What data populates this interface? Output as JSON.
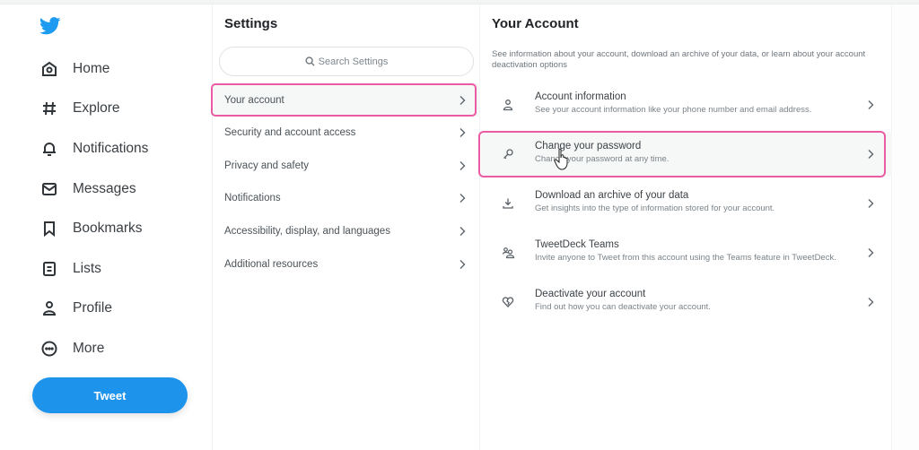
{
  "nav": {
    "logo": "twitter-bird-icon",
    "items": [
      {
        "label": "Home",
        "icon": "home-icon"
      },
      {
        "label": "Explore",
        "icon": "hashtag-icon"
      },
      {
        "label": "Notifications",
        "icon": "bell-icon"
      },
      {
        "label": "Messages",
        "icon": "envelope-icon"
      },
      {
        "label": "Bookmarks",
        "icon": "bookmark-icon"
      },
      {
        "label": "Lists",
        "icon": "list-icon"
      },
      {
        "label": "Profile",
        "icon": "person-icon"
      },
      {
        "label": "More",
        "icon": "more-circle-icon"
      }
    ],
    "tweet_label": "Tweet"
  },
  "settings": {
    "title": "Settings",
    "search_placeholder": "Search Settings",
    "items": [
      {
        "label": "Your account",
        "active": true
      },
      {
        "label": "Security and account access"
      },
      {
        "label": "Privacy and safety"
      },
      {
        "label": "Notifications"
      },
      {
        "label": "Accessibility, display, and languages"
      },
      {
        "label": "Additional resources"
      }
    ]
  },
  "account": {
    "title": "Your Account",
    "description": "See information about your account, download an archive of your data, or learn about your account deactivation options",
    "items": [
      {
        "title": "Account information",
        "subtitle": "See your account information like your phone number and email address.",
        "icon": "person-icon"
      },
      {
        "title": "Change your password",
        "subtitle": "Change your password at any time.",
        "icon": "key-icon",
        "active": true
      },
      {
        "title": "Download an archive of your data",
        "subtitle": "Get insights into the type of information stored for your account.",
        "icon": "download-icon"
      },
      {
        "title": "TweetDeck Teams",
        "subtitle": "Invite anyone to Tweet from this account using the Teams feature in TweetDeck.",
        "icon": "people-icon"
      },
      {
        "title": "Deactivate your account",
        "subtitle": "Find out how you can deactivate your account.",
        "icon": "broken-heart-icon"
      }
    ]
  },
  "colors": {
    "brand": "#1d9bf0",
    "highlight": "#ea5ba3"
  }
}
